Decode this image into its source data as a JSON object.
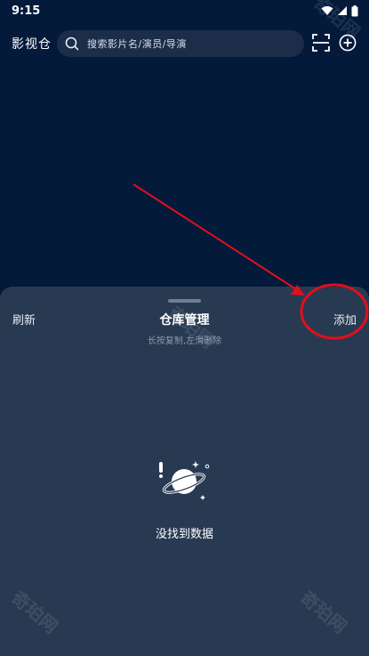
{
  "status_bar": {
    "time": "9:15"
  },
  "top_bar": {
    "app_title": "影视仓",
    "search_placeholder": "搜索影片名/演员/导演"
  },
  "sheet": {
    "refresh_label": "刷新",
    "title": "仓库管理",
    "subtitle": "长按复制,左滑删除",
    "add_label": "添加",
    "empty_text": "没找到数据"
  },
  "watermark": {
    "text": "奇珀网"
  },
  "colors": {
    "background": "#041a3b",
    "sheet": "#283a52",
    "search_box": "#1b2d49",
    "annotation_red": "#e0101a"
  },
  "icons": {
    "status": [
      "wifi-icon",
      "signal-icon",
      "battery-icon"
    ],
    "search": "search-icon",
    "scan": "scan-icon",
    "add": "add-circle-icon",
    "empty": "planet-icon"
  }
}
